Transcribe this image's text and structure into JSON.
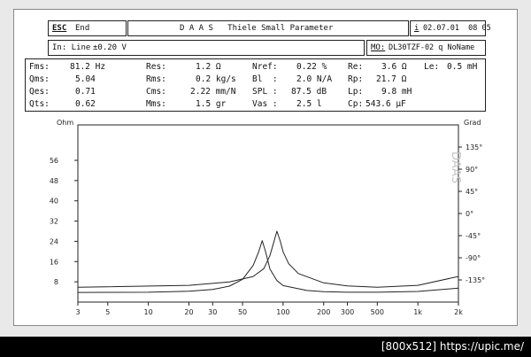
{
  "header": {
    "esc_key": "ESC",
    "end_label": "End",
    "title": "D A A S   Thiele Small Parameter",
    "info_icon_label": "i",
    "datetime": "02.07.01  08 05"
  },
  "subheader": {
    "input_label": "In: Line",
    "input_level": "±0.20 V",
    "mo_label": "MO:",
    "model_name": "DL30TZF-02 q NoName"
  },
  "parameters": [
    [
      {
        "name": "Fms:",
        "value": "81.2 Hz"
      },
      {
        "name": "Res:",
        "value": "1.2 Ω"
      },
      {
        "name": "Nref:",
        "value": "0.22 %"
      },
      {
        "name": "Re:",
        "value": "3.6 Ω"
      },
      {
        "name": "Le:",
        "value": "0.5 mH"
      }
    ],
    [
      {
        "name": "Qms:",
        "value": "5.04"
      },
      {
        "name": "Rms:",
        "value": "0.2 kg/s"
      },
      {
        "name": "Bl  :",
        "value": "2.0 N/A"
      },
      {
        "name": "Rp:",
        "value": "21.7 Ω"
      }
    ],
    [
      {
        "name": "Qes:",
        "value": "0.71"
      },
      {
        "name": "Cms:",
        "value": "2.22 mm/N"
      },
      {
        "name": "SPL :",
        "value": "87.5 dB"
      },
      {
        "name": "Lp:",
        "value": "9.8 mH"
      }
    ],
    [
      {
        "name": "Qts:",
        "value": "0.62"
      },
      {
        "name": "Mms:",
        "value": "1.5 gr"
      },
      {
        "name": "Vas :",
        "value": "2.5 l"
      },
      {
        "name": "Cp:",
        "value": "543.6 μF"
      }
    ]
  ],
  "chart_data": {
    "type": "line",
    "left_axis_label": "Ohm",
    "right_axis_label": "Grad",
    "watermark": "DAAS",
    "x_scale": "log",
    "x_range": [
      3,
      2000
    ],
    "x_tick_labels": [
      "3",
      "5",
      "10",
      "20",
      "30",
      "50",
      "100",
      "200",
      "300",
      "500",
      "1k",
      "2k"
    ],
    "x_ticks": [
      3,
      5,
      10,
      20,
      30,
      50,
      100,
      200,
      300,
      500,
      1000,
      2000
    ],
    "y_left_range": [
      0,
      70
    ],
    "y_left_ticks": [
      8,
      16,
      24,
      32,
      40,
      48,
      56
    ],
    "y_left_tick_labels": [
      "8",
      "16",
      "24",
      "32",
      "40",
      "48",
      "56"
    ],
    "y_right_range": [
      -180,
      180
    ],
    "y_right_ticks": [
      -135,
      -90,
      -45,
      0,
      45,
      90,
      135
    ],
    "y_right_tick_labels": [
      "-135°",
      "-90°",
      "-45°",
      "0°",
      "45°",
      "90°",
      "135°"
    ],
    "grid": false,
    "series": [
      {
        "axis": "left",
        "color": "#222",
        "points": [
          [
            3,
            3.8
          ],
          [
            10,
            3.9
          ],
          [
            20,
            4.3
          ],
          [
            30,
            5.0
          ],
          [
            40,
            6.3
          ],
          [
            50,
            9.0
          ],
          [
            60,
            14.5
          ],
          [
            66,
            20
          ],
          [
            70,
            24.3
          ],
          [
            74,
            20
          ],
          [
            80,
            13
          ],
          [
            90,
            8.5
          ],
          [
            100,
            6.5
          ],
          [
            150,
            4.6
          ],
          [
            200,
            4.1
          ],
          [
            300,
            3.9
          ],
          [
            500,
            3.9
          ],
          [
            1000,
            4.2
          ],
          [
            2000,
            5.5
          ]
        ]
      },
      {
        "axis": "right",
        "color": "#222",
        "points": [
          [
            3,
            -150
          ],
          [
            20,
            -146
          ],
          [
            40,
            -139
          ],
          [
            60,
            -128
          ],
          [
            72,
            -112
          ],
          [
            80,
            -85
          ],
          [
            85,
            -60
          ],
          [
            90,
            -36
          ],
          [
            95,
            -55
          ],
          [
            100,
            -78
          ],
          [
            110,
            -102
          ],
          [
            130,
            -122
          ],
          [
            200,
            -141
          ],
          [
            300,
            -147
          ],
          [
            500,
            -150
          ],
          [
            1000,
            -146
          ],
          [
            2000,
            -128
          ]
        ]
      }
    ]
  }
}
